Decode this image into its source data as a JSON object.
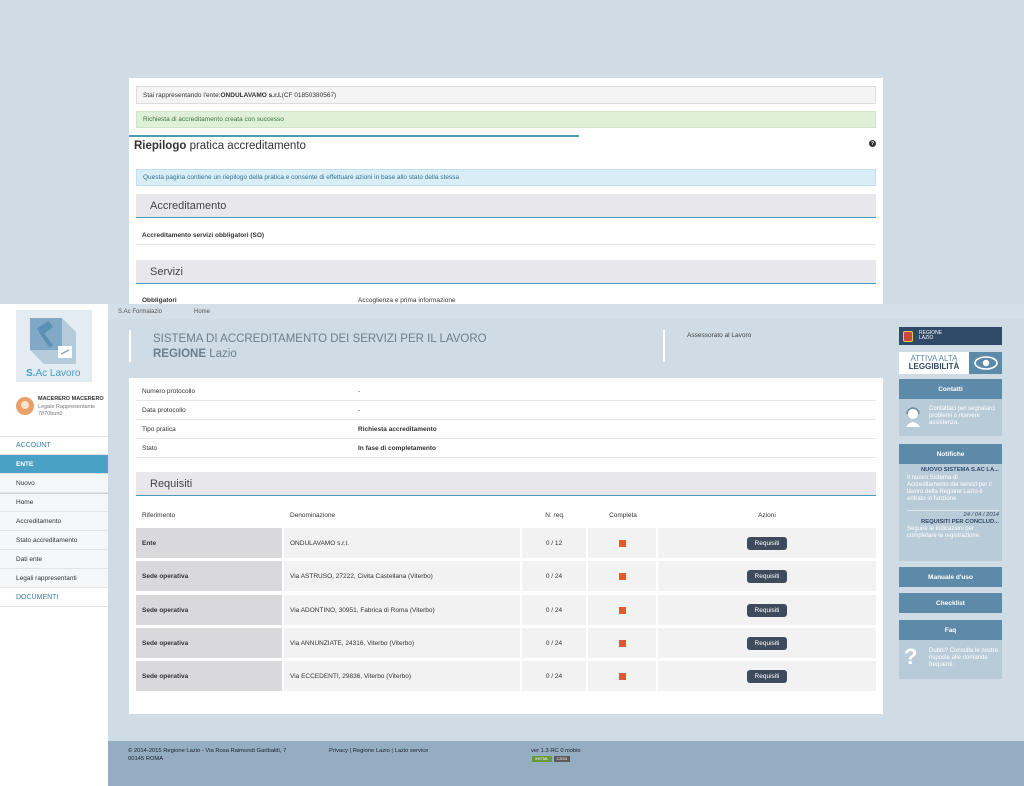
{
  "overlay": {
    "ente_prefix": "Stai rappresentando l'ente: ",
    "ente_name": "ONDULAVAMO s.r.l.",
    "ente_cf": " (CF 01850380567)",
    "success_msg": "Richiesta di accreditamento creata con successo",
    "title_bold": "Riepilogo",
    "title_rest": " pratica accreditamento",
    "help_icon": "?",
    "info_msg": "Questa pagina contiene un riepilogo della pratica e consente di effettuare azioni in base allo stato della stessa",
    "section1": "Accreditamento",
    "row1": "Accreditamento servizi obbligatori (SO)",
    "section2": "Servizi",
    "row2_k": "Obbligatori",
    "row2_v": "Accoglienza e prima informazione"
  },
  "breadcrumb": {
    "root": "S.Ac Formalazio",
    "home": "Home"
  },
  "header": {
    "title_line1": "SISTEMA DI ACCREDITAMENTO DEI SERVIZI PER IL LAVORO",
    "title_bold": "REGIONE",
    "title_rest": " Lazio",
    "assessorato": "Assessorato al Lavoro"
  },
  "sidebar": {
    "logo_s": "S.",
    "logo_rest": "Ac Lavoro",
    "user_name": "MACERERO MACERERO",
    "user_role": "Legale Rappresentante",
    "user_id": "7870bun0",
    "items": [
      {
        "label": "ACCOUNT"
      },
      {
        "label": "ENTE"
      },
      {
        "label": "Nuovo"
      },
      {
        "label": "Home"
      },
      {
        "label": "Accreditamento"
      },
      {
        "label": "Stato accreditamento"
      },
      {
        "label": "Dati ente"
      },
      {
        "label": "Legali rappresentanti"
      },
      {
        "label": "DOCUMENTI"
      }
    ]
  },
  "pratica": [
    {
      "k": "Numero protocollo",
      "v": "-"
    },
    {
      "k": "Data protocollo",
      "v": "-"
    },
    {
      "k": "Tipo pratica",
      "v": "Richiesta accreditamento"
    },
    {
      "k": "Stato",
      "v": "In fase di completamento"
    }
  ],
  "requisiti": {
    "section": "Requisiti",
    "headers": [
      "Riferimento",
      "Denominazione",
      "N. req.",
      "Completa",
      "Azioni"
    ],
    "button": "Requisiti",
    "rows": [
      {
        "rif": "Ente",
        "den": "ONDULAVAMO s.r.l.",
        "n": "0 / 12"
      },
      {
        "rif": "Sede operativa",
        "den": "Via ASTRUSO, 27222, Civita Castellana (Viterbo)",
        "n": "0 / 24"
      },
      {
        "rif": "Sede operativa",
        "den": "Via ADONTINO, 30951, Fabrica di Roma (Viterbo)",
        "n": "0 / 24"
      },
      {
        "rif": "Sede operativa",
        "den": "Via ANNUNZIATE, 24316, Viterbo (Viterbo)",
        "n": "0 / 24"
      },
      {
        "rif": "Sede operativa",
        "den": "Via ECCEDENTI, 29836, Viterbo (Viterbo)",
        "n": "0 / 24"
      }
    ]
  },
  "right": {
    "regione_logo": "REGIONE LAZIO",
    "legg_line1": "ATTIVA ALTA",
    "legg_line2": "LEGGIBILITÀ",
    "contatti": "Contatti",
    "contatti_text": "Contattaci per segnalarci problemi o ricevere assistenza.",
    "notifiche": "Notifiche",
    "notif1_title": "NUOVO SISTEMA S.AC LA...",
    "notif1_text": "Il nuovo Sistema di Accreditamento dei servizi per il lavoro della Regione Lazio è entrato in funzione",
    "notif2_date": "24 / 04 / 2014",
    "notif2_title": "REQUISITI PER CONCLUD...",
    "notif2_text": "Seguire le indicazioni per completare la registrazione.",
    "manuale": "Manuale d'uso",
    "checklist": "Checklist",
    "faq": "Faq",
    "faq_text": "Dubbi? Consulta le nostre risposte alle domande frequenti."
  },
  "footer": {
    "copy1": "© 2014-2015 Regione Lazio - Via Rosa Raimondi Garibaldi, 7",
    "copy2": "00145 ROMA",
    "links": "Privacy | Regione Lazio | Lazio service",
    "version": "ver 1.3 RC 0 niobio",
    "badge1": "XHTML",
    "badge2": "CSS3"
  }
}
